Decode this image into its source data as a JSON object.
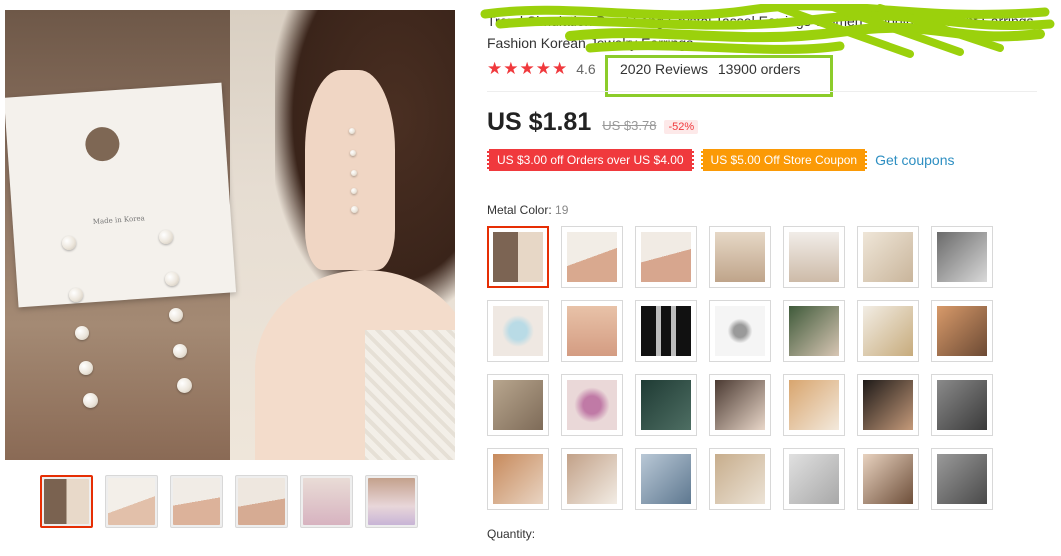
{
  "product": {
    "title": "Trend Simulation Pearl Long Crystal Tassel Earrings Women Wedding Pendant Earrings Fashion Korean Jewelry Earrings",
    "rating": "4.6",
    "reviews": "2020 Reviews",
    "orders": "13900 orders",
    "price": "US $1.81",
    "original_price": "US $3.78",
    "discount": "-52%"
  },
  "coupons": {
    "coupon1": "US $3.00 off Orders over US $4.00",
    "coupon2": "US $5.00 Off Store Coupon",
    "get_coupons": "Get coupons"
  },
  "options": {
    "label": "Metal Color:",
    "count": "19"
  },
  "quantity": {
    "label": "Quantity:"
  },
  "colors": {
    "star": "#f0393d",
    "selected_border": "#e62e04",
    "highlight_box": "#8ccc2a",
    "coupon_red": "#f0393d",
    "coupon_orange": "#fb9a06",
    "link": "#2e8fc2"
  },
  "gallery": {
    "thumb_count": 6,
    "active_index": 0
  },
  "swatch_grid": {
    "rows": 4,
    "cols": 7,
    "selected_index": 0
  }
}
